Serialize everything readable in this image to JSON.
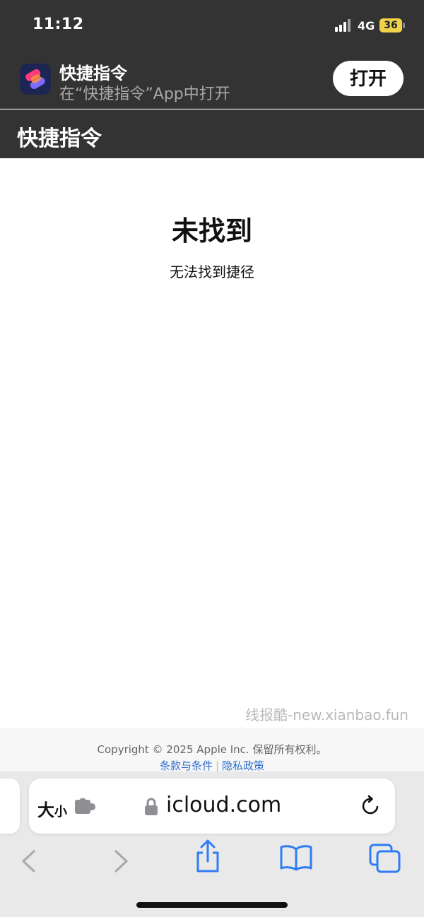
{
  "status_bar": {
    "time": "11:12",
    "network": "4G",
    "battery": "36",
    "battery_color": "#f0d34a"
  },
  "app_banner": {
    "app_name": "快捷指令",
    "subtitle": "在“快捷指令”App中打开",
    "open_button": "打开"
  },
  "header": {
    "title": "快捷指令"
  },
  "main": {
    "title": "未找到",
    "message": "无法找到捷径"
  },
  "watermark": "线报酷-new.xianbao.fun",
  "footer": {
    "copyright": "Copyright © 2025 Apple Inc. 保留所有权利。",
    "links": [
      "条款与条件",
      "隐私政策"
    ],
    "link_color": "#2e6fd0"
  },
  "browser": {
    "size_label_big": "大",
    "size_label_small": "小",
    "url": "icloud.com",
    "accent_color": "#2f7cf6",
    "icons": [
      "puzzle-icon",
      "lock-icon",
      "reload-icon",
      "back-icon",
      "forward-icon",
      "share-icon",
      "bookmarks-icon",
      "tabs-icon"
    ]
  }
}
